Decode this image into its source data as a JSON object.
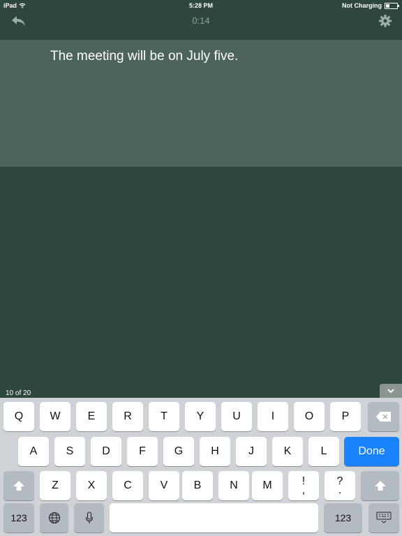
{
  "status_bar": {
    "device": "iPad",
    "time": "5:28 PM",
    "charge_status": "Not Charging"
  },
  "top_bar": {
    "timer": "0:14",
    "back_icon": "back-arrow-icon",
    "settings_icon": "gear-icon"
  },
  "sentence": "The meeting will be on July five.",
  "progress": "10 of 20",
  "keyboard": {
    "row1": [
      "Q",
      "W",
      "E",
      "R",
      "T",
      "Y",
      "U",
      "I",
      "O",
      "P"
    ],
    "row2": [
      "A",
      "S",
      "D",
      "F",
      "G",
      "H",
      "J",
      "K",
      "L"
    ],
    "row3": [
      "Z",
      "X",
      "C",
      "V",
      "B",
      "N",
      "M"
    ],
    "punct1_top": "!",
    "punct1_bottom": ",",
    "punct2_top": "?",
    "punct2_bottom": ".",
    "done_label": "Done",
    "numbers_label": "123"
  },
  "colors": {
    "background": "#2d463f",
    "sentence_panel": "#4d645d",
    "done_key": "#1a82fb"
  }
}
